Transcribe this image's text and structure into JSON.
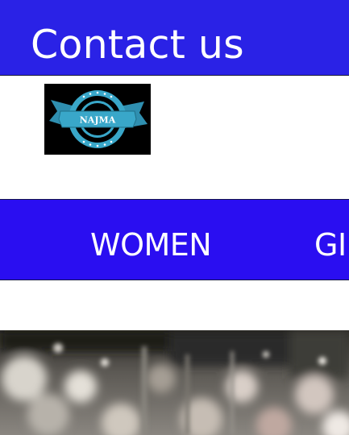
{
  "header": {
    "title": "Contact us",
    "background": "#2a22e6"
  },
  "logo": {
    "text": "NAJMA",
    "icon": "najma-badge-logo",
    "ribbon_color": "#39a7c9"
  },
  "nav": {
    "background": "#2a0ef1",
    "items": [
      {
        "label": "WOMEN"
      },
      {
        "label": "GI"
      }
    ]
  },
  "hero": {
    "description_icon": "blurred-boutique-photo"
  }
}
